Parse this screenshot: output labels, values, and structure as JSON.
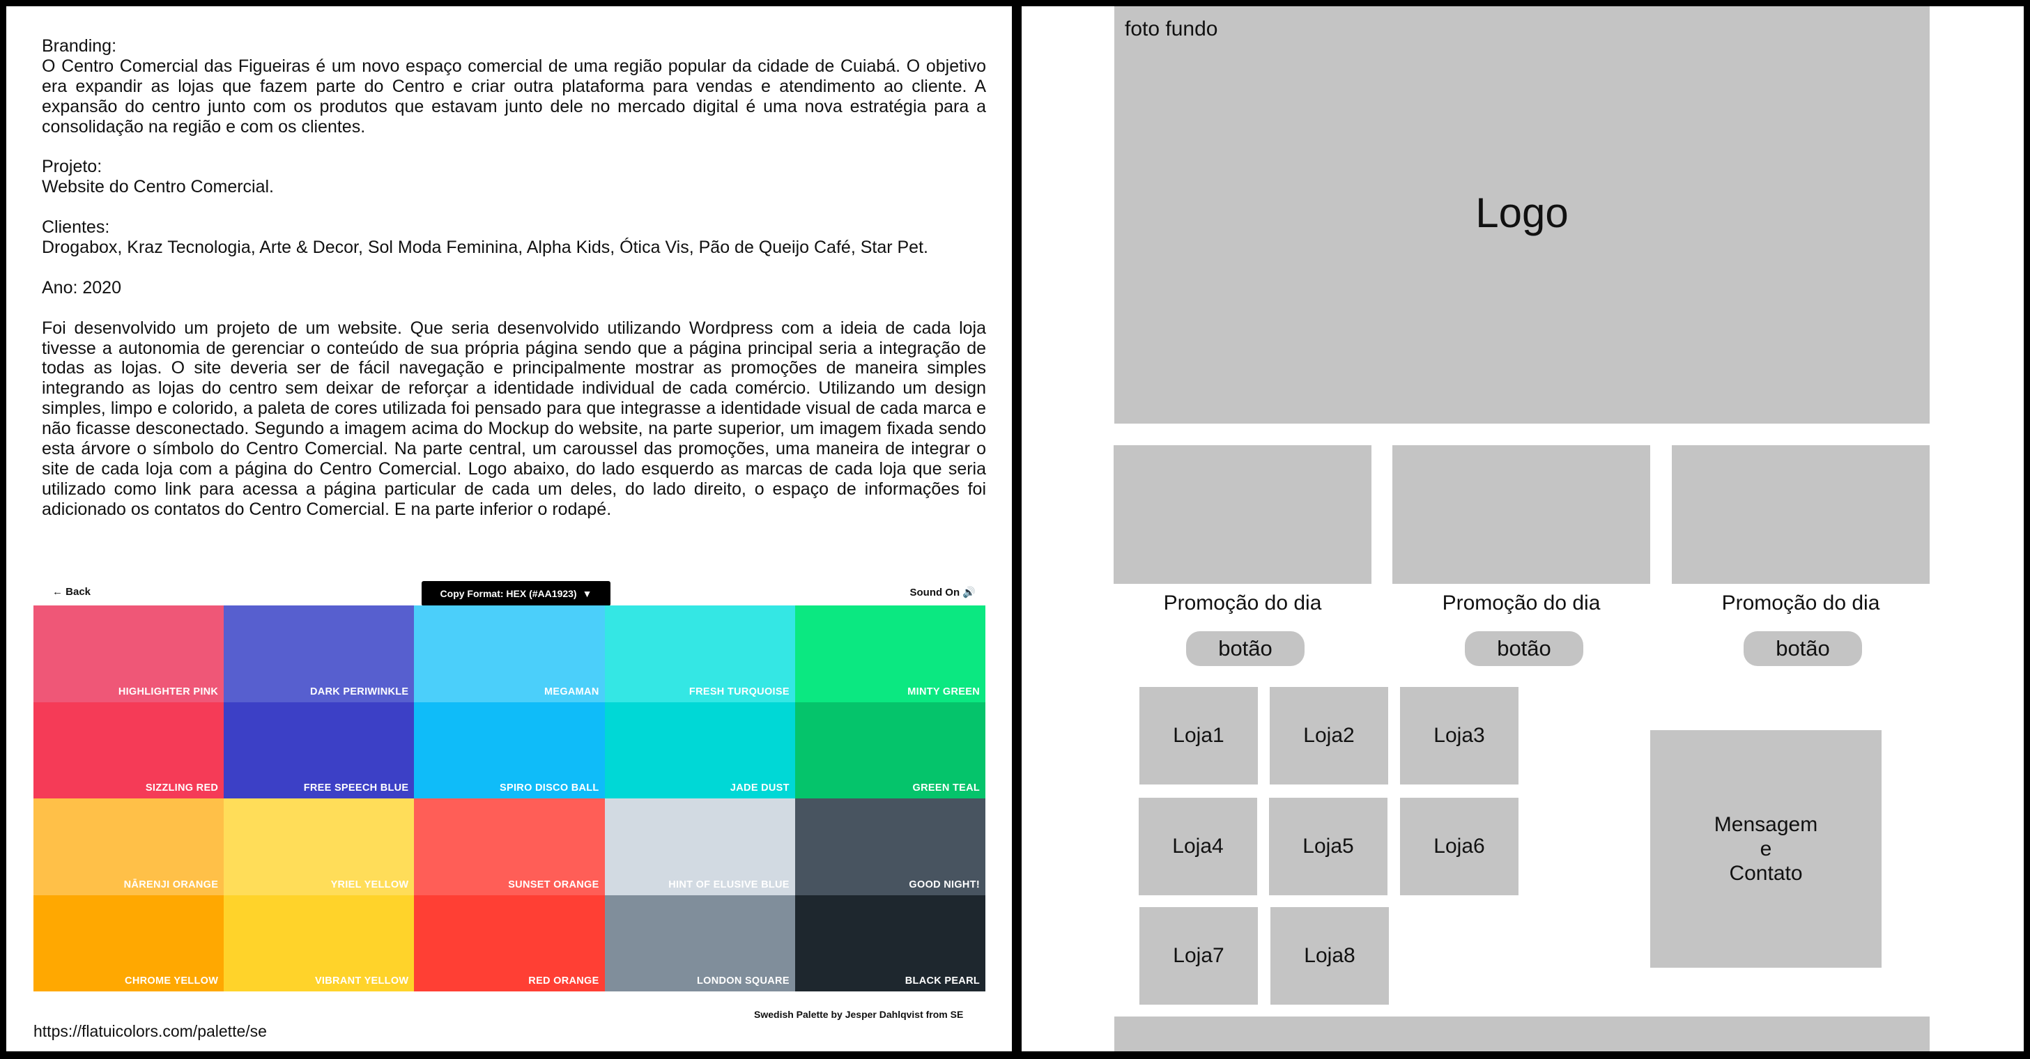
{
  "document": {
    "branding_label": "Branding:",
    "branding_text": "O Centro Comercial das Figueiras é um novo espaço comercial de uma região popular da cidade de Cuiabá. O objetivo era expandir as lojas que fazem parte do Centro e criar outra plataforma para vendas e atendimento ao cliente. A expansão do centro junto com os produtos que estavam junto dele no mercado digital é uma nova estratégia para a consolidação na região e com os clientes.",
    "projeto_label": "Projeto:",
    "projeto_text": "Website do Centro Comercial.",
    "clientes_label": "Clientes:",
    "clientes_text": "Drogabox, Kraz Tecnologia, Arte & Decor, Sol Moda Feminina, Alpha Kids, Ótica Vis, Pão de Queijo Café, Star Pet.",
    "ano_text": "Ano: 2020",
    "description": "Foi desenvolvido um projeto de um website. Que seria desenvolvido utilizando Wordpress com a ideia de cada loja tivesse a autonomia de gerenciar o conteúdo de sua própria página sendo que a página principal seria a integração de todas as lojas. O site deveria ser de fácil navegação e principalmente mostrar as promoções de maneira simples integrando as lojas do centro sem deixar de reforçar a identidade individual de cada comércio. Utilizando um design simples, limpo e colorido, a paleta de cores utilizada foi pensado para que integrasse a identidade visual de cada marca e não ficasse desconectado. Segundo a imagem acima do Mockup do website, na parte superior, um imagem fixada sendo esta árvore o símbolo do Centro Comercial. Na parte central, um caroussel das promoções, uma maneira de integrar o site de cada loja com a página do Centro Comercial. Logo abaixo, do lado esquerdo as marcas de cada loja que seria utilizado como link para acessa a página particular de cada um deles, do lado direito, o espaço de informações foi adicionado os contatos do Centro Comercial. E na parte inferior o rodapé."
  },
  "palette": {
    "back_label": "← Back",
    "copy_format_label": "Copy Format: HEX (#AA1923)",
    "copy_format_caret": "▼",
    "sound_label": "Sound On",
    "sound_icon": "🔊",
    "credit": "Swedish Palette by Jesper Dahlqvist from SE",
    "source_url": "https://flatuicolors.com/palette/se",
    "swatches": [
      {
        "name": "HIGHLIGHTER PINK",
        "color": "#ef5777"
      },
      {
        "name": "DARK PERIWINKLE",
        "color": "#575fcf"
      },
      {
        "name": "MEGAMAN",
        "color": "#4bcffa"
      },
      {
        "name": "FRESH TURQUOISE",
        "color": "#34e7e4"
      },
      {
        "name": "MINTY GREEN",
        "color": "#0be881"
      },
      {
        "name": "SIZZLING RED",
        "color": "#f53b57"
      },
      {
        "name": "FREE SPEECH BLUE",
        "color": "#3c40c6"
      },
      {
        "name": "SPIRO DISCO BALL",
        "color": "#0fbcf9"
      },
      {
        "name": "JADE DUST",
        "color": "#00d8d6"
      },
      {
        "name": "GREEN TEAL",
        "color": "#05c46b"
      },
      {
        "name": "NĀRENJI ORANGE",
        "color": "#ffc048"
      },
      {
        "name": "YRIEL YELLOW",
        "color": "#ffdd59"
      },
      {
        "name": "SUNSET ORANGE",
        "color": "#ff5e57"
      },
      {
        "name": "HINT OF ELUSIVE BLUE",
        "color": "#d2dae2"
      },
      {
        "name": "GOOD NIGHT!",
        "color": "#485460"
      },
      {
        "name": "CHROME YELLOW",
        "color": "#ffa801"
      },
      {
        "name": "VIBRANT YELLOW",
        "color": "#ffd32a"
      },
      {
        "name": "RED ORANGE",
        "color": "#ff3f34"
      },
      {
        "name": "LONDON SQUARE",
        "color": "#808e9b"
      },
      {
        "name": "BLACK PEARL",
        "color": "#1e272e"
      }
    ]
  },
  "wireframe": {
    "hero_label": "foto fundo",
    "logo_label": "Logo",
    "promotions": [
      {
        "label": "Promoção do dia",
        "button": "botão"
      },
      {
        "label": "Promoção do dia",
        "button": "botão"
      },
      {
        "label": "Promoção do dia",
        "button": "botão"
      }
    ],
    "stores": [
      "Loja1",
      "Loja2",
      "Loja3",
      "Loja4",
      "Loja5",
      "Loja6",
      "Loja7",
      "Loja8"
    ],
    "contact_lines": [
      "Mensagem",
      "e",
      "Contato"
    ],
    "box_color": "#c4c4c4"
  }
}
